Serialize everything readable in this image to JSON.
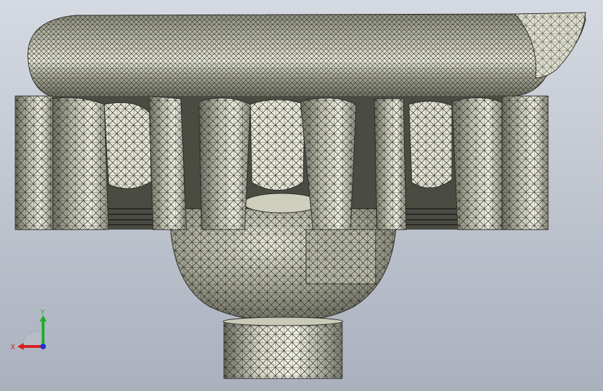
{
  "viewport": {
    "background_top": "#d5d9e1",
    "background_bottom": "#aab1bd"
  },
  "model": {
    "name": "",
    "display_mode": "shaded-with-mesh-edges",
    "face_color": "#9fa08e",
    "edge_color": "#2d2d2a",
    "highlight_color": "#f3f3e6"
  },
  "triad": {
    "x_label": "X",
    "y_label": "Y",
    "x_color": "#d81f1f",
    "y_color": "#1fae2d",
    "z_color": "#1f2fd8"
  }
}
